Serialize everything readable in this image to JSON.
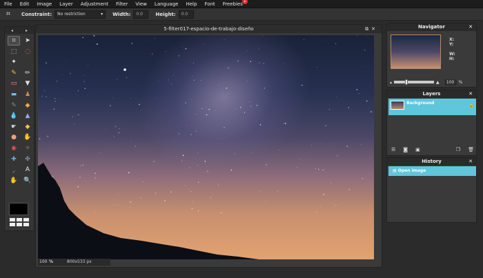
{
  "menu": {
    "items": [
      "File",
      "Edit",
      "Image",
      "Layer",
      "Adjustment",
      "Filter",
      "View",
      "Language",
      "Help",
      "Font",
      "Freebies"
    ],
    "freebies_badge": "1"
  },
  "options": {
    "tool_icon": "crop-icon",
    "constraint_label": "Constraint:",
    "constraint_value": "No restriction",
    "width_label": "Width:",
    "width_value": "0.0",
    "height_label": "Height:",
    "height_value": "0.0"
  },
  "tools": {
    "header_left": "◂",
    "header_right": "▸",
    "icons": [
      "crop-icon",
      "move-icon",
      "marquee-icon",
      "lasso-icon",
      "magic-wand-icon",
      "",
      "pencil-icon",
      "brush-icon",
      "eraser-icon",
      "bucket-icon",
      "gradient-icon",
      "stamp-icon",
      "color-replace-icon",
      "bandage-icon",
      "blur-icon",
      "sharpen-icon",
      "smudge-icon",
      "sponge-icon",
      "dodge-icon",
      "burn-icon",
      "red-eye-icon",
      "spot-heal-icon",
      "bloat-icon",
      "pinch-icon",
      "eyedropper-icon",
      "type-icon",
      "hand-icon",
      "zoom-icon"
    ],
    "glyphs": [
      "⌗",
      "➤",
      "⬚",
      "◌",
      "✦",
      "",
      "✎",
      "✏",
      "▭",
      "▼",
      "▬",
      "♟",
      "✎",
      "◆",
      "💧",
      "▲",
      "☛",
      "◆",
      "●",
      "✋",
      "◉",
      "✧",
      "✚",
      "✤",
      "⸝",
      "A",
      "✋",
      "🔍"
    ],
    "foreground_color": "#000000"
  },
  "image": {
    "title": "5-filter017-espacio-de-trabajo-diseño",
    "zoom": "100",
    "zoom_unit": "%",
    "dimensions": "800x533 px"
  },
  "navigator": {
    "title": "Navigator",
    "x_label": "X:",
    "y_label": "Y:",
    "w_label": "W:",
    "h_label": "H:",
    "zoom": "100",
    "zoom_unit": "%"
  },
  "layers": {
    "title": "Layers",
    "items": [
      {
        "name": "Background"
      }
    ]
  },
  "history": {
    "title": "History",
    "items": [
      {
        "name": "Open image"
      }
    ]
  }
}
